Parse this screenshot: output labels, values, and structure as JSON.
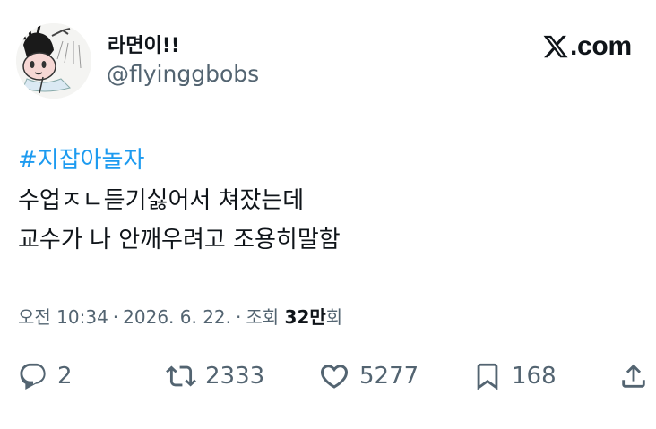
{
  "author": {
    "display_name": "라면이!!",
    "handle": "@flyinggbobs"
  },
  "brand": {
    "logo_text": ".com"
  },
  "tweet": {
    "hashtag": "#지잡아놀자",
    "line1": "수업ㅈㄴ듣기싫어서 쳐잤는데",
    "line2": "교수가 나 안깨우려고 조용히말함"
  },
  "meta": {
    "time": "오전 10:34",
    "date": "2026. 6. 22.",
    "views_label": "조회",
    "views_value": "32만",
    "views_suffix": "회",
    "separator": "·"
  },
  "actions": {
    "reply_count": "2",
    "retweet_count": "2333",
    "like_count": "5277",
    "bookmark_count": "168"
  },
  "colors": {
    "text": "#0f1419",
    "secondary": "#536471",
    "accent": "#1d9bf0"
  },
  "icons": [
    "avatar-illustration",
    "x-logo-icon",
    "reply-icon",
    "retweet-icon",
    "like-icon",
    "bookmark-icon",
    "share-icon"
  ]
}
